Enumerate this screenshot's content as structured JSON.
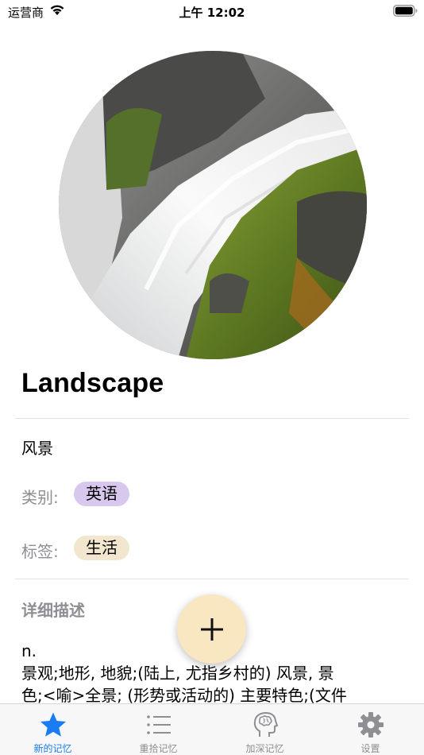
{
  "status_bar": {
    "carrier": "运营商",
    "time": "上午 12:02"
  },
  "word": {
    "title": "Landscape",
    "meaning": "风景",
    "category_label": "类别:",
    "category_value": "英语",
    "tag_label": "标签:",
    "tag_value": "生活",
    "description_title": "详细描述",
    "description_lines": [
      "n.",
      "景观;地形, 地貌;(陆上, 尤指乡村的) 风景, 景",
      "色;<喻>全景; (形势或活动的) 主要特色;(文件"
    ]
  },
  "colors": {
    "category_chip": "#d9c8ee",
    "tag_chip": "#f3e6cf",
    "fab": "#f8e7c0",
    "tab_active": "#1a7cf5",
    "tab_inactive": "#8e8e93"
  },
  "tabs": [
    {
      "label": "新的记忆",
      "icon": "star-icon",
      "active": true
    },
    {
      "label": "重拾记忆",
      "icon": "list-icon",
      "active": false
    },
    {
      "label": "加深记忆",
      "icon": "brain-head-icon",
      "active": false
    },
    {
      "label": "设置",
      "icon": "gear-icon",
      "active": false
    }
  ]
}
